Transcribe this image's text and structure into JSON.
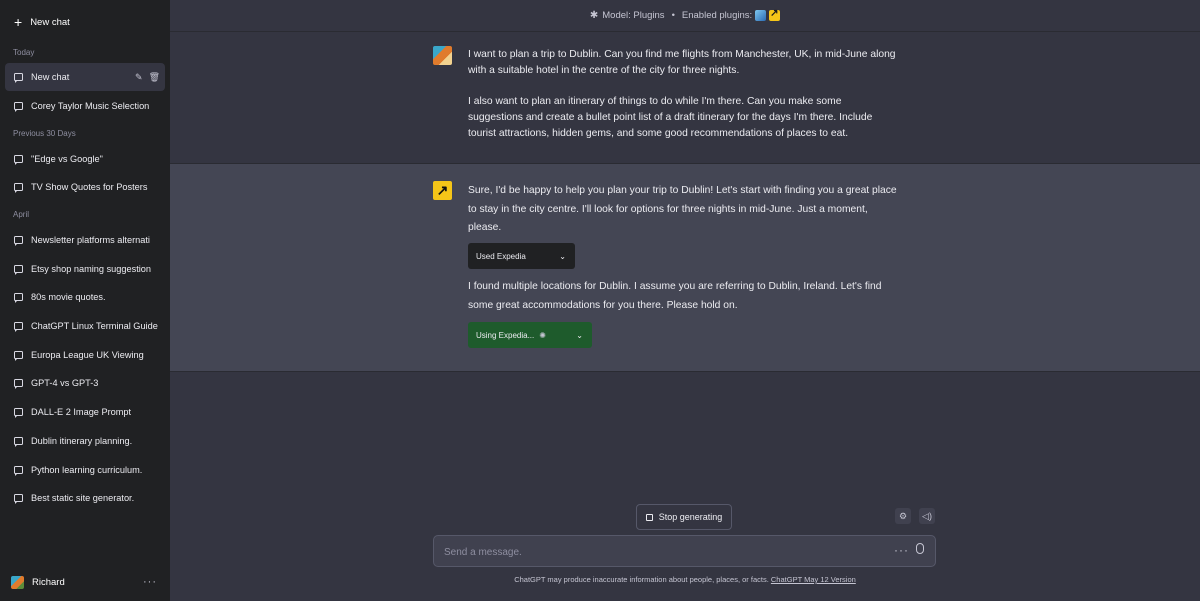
{
  "sidebar": {
    "new_chat": "New chat",
    "sections": [
      {
        "label": "Today"
      },
      {
        "label": "Previous 30 Days"
      },
      {
        "label": "April"
      }
    ],
    "items": [
      "New chat",
      "Corey Taylor Music Selection",
      "\"Edge vs Google\"",
      "TV Show Quotes for Posters",
      "Newsletter platforms alternati",
      "Etsy shop naming suggestion",
      "80s movie quotes.",
      "ChatGPT Linux Terminal Guide",
      "Europa League UK Viewing",
      "GPT-4 vs GPT-3",
      "DALL-E 2 Image Prompt",
      "Dublin itinerary planning.",
      "Python learning curriculum.",
      "Best static site generator."
    ],
    "user": "Richard"
  },
  "topbar": {
    "model": "Model: Plugins",
    "plugins": "Enabled plugins:"
  },
  "messages": {
    "user_p1": "I want to plan a trip to Dublin. Can you find me flights from Manchester, UK, in mid-June along with a suitable hotel in the centre of the city for three nights.",
    "user_p2": "I also want to plan an itinerary of things to do while I'm there. Can you make some suggestions and create a bullet point list of a draft itinerary for the days I'm there. Include tourist attractions, hidden gems, and some good recommendations of places to eat.",
    "bot_p1": "Sure, I'd be happy to help you plan your trip to Dublin! Let's start with finding you a great place to stay in the city centre. I'll look for options for three nights in mid-June. Just a moment, please.",
    "plugin_used": "Used Expedia",
    "bot_p2": "I found multiple locations for Dublin. I assume you are referring to Dublin, Ireland. Let's find some great accommodations for you there. Please hold on.",
    "plugin_using": "Using Expedia..."
  },
  "composer": {
    "stop": "Stop generating",
    "placeholder": "Send a message.",
    "disclaimer": "ChatGPT may produce inaccurate information about people, places, or facts.",
    "version_link": "ChatGPT May 12 Version"
  }
}
